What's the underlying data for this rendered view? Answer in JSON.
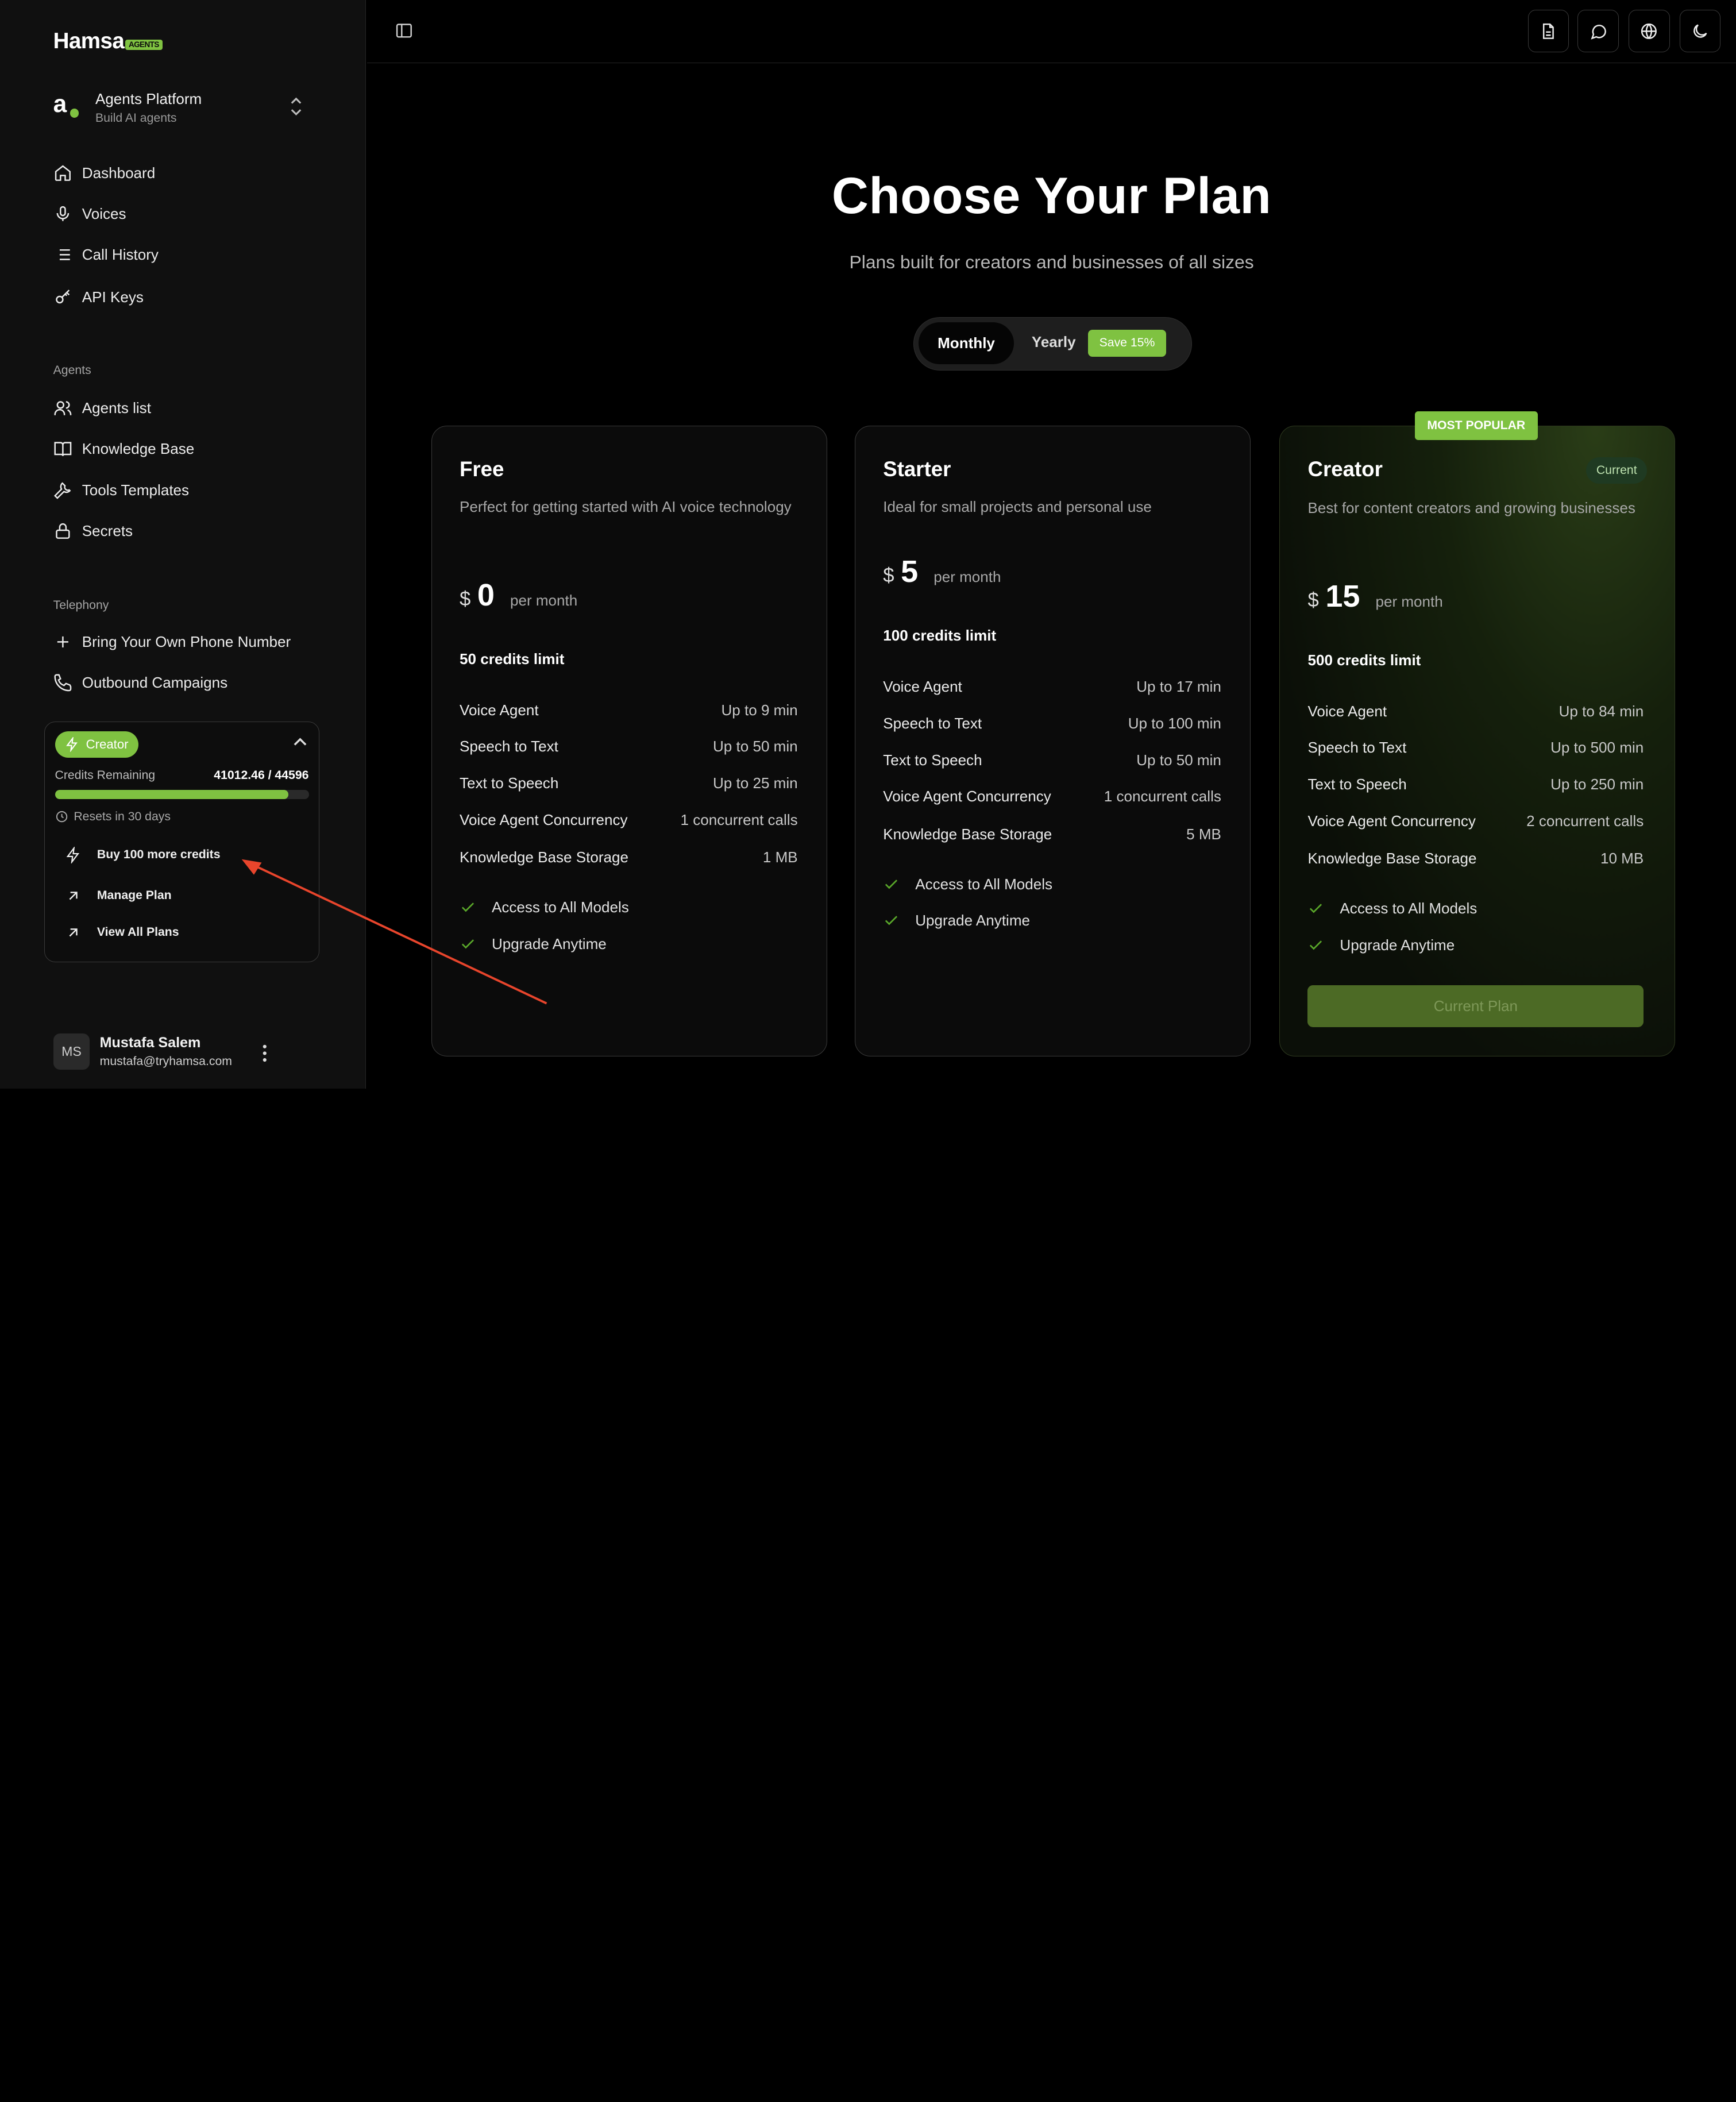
{
  "brand": {
    "name": "Hamsa",
    "tag": "AGENTS"
  },
  "workspace": {
    "title": "Agents Platform",
    "subtitle": "Build AI agents",
    "icon_letter": "a"
  },
  "nav": {
    "main": [
      {
        "label": "Dashboard",
        "icon": "home-icon"
      },
      {
        "label": "Voices",
        "icon": "microphone-icon"
      },
      {
        "label": "Call History",
        "icon": "list-icon"
      },
      {
        "label": "API Keys",
        "icon": "key-icon"
      }
    ],
    "agents_label": "Agents",
    "agents": [
      {
        "label": "Agents list",
        "icon": "users-icon"
      },
      {
        "label": "Knowledge Base",
        "icon": "book-icon"
      },
      {
        "label": "Tools Templates",
        "icon": "wrench-icon"
      },
      {
        "label": "Secrets",
        "icon": "lock-icon"
      }
    ],
    "telephony_label": "Telephony",
    "telephony": [
      {
        "label": "Bring Your Own Phone Number",
        "icon": "plus-icon"
      },
      {
        "label": "Outbound Campaigns",
        "icon": "phone-icon"
      }
    ]
  },
  "plan_widget": {
    "plan": "Creator",
    "credits_label": "Credits Remaining",
    "credits_value": "41012.46 / 44596",
    "credits_fraction": 0.9196,
    "resets": "Resets in 30 days",
    "links": [
      "Buy 100 more credits",
      "Manage Plan",
      "View All Plans"
    ]
  },
  "user": {
    "initials": "MS",
    "name": "Mustafa Salem",
    "email": "mustafa@tryhamsa.com"
  },
  "topbar": {
    "icons": [
      "document-icon",
      "chat-icon",
      "globe-icon",
      "moon-icon"
    ]
  },
  "hero": {
    "title": "Choose Your Plan",
    "subtitle": "Plans built for creators and businesses of all sizes"
  },
  "billing": {
    "monthly": "Monthly",
    "yearly": "Yearly",
    "save": "Save 15%",
    "selected": "Monthly"
  },
  "plans": [
    {
      "name": "Free",
      "desc": "Perfect for getting started with AI voice technology",
      "currency": "$",
      "price": "0",
      "period": "per month",
      "limit": "50 credits limit",
      "features": [
        {
          "k": "Voice Agent",
          "v": "Up to 9 min"
        },
        {
          "k": "Speech to Text",
          "v": "Up to 50 min"
        },
        {
          "k": "Text to Speech",
          "v": "Up to 25 min"
        },
        {
          "k": "Voice Agent Concurrency",
          "v": "1 concurrent calls"
        },
        {
          "k": "Knowledge Base Storage",
          "v": "1 MB"
        }
      ],
      "checks": [
        "Access to All Models",
        "Upgrade Anytime"
      ]
    },
    {
      "name": "Starter",
      "desc": "Ideal for small projects and personal use",
      "currency": "$",
      "price": "5",
      "period": "per month",
      "limit": "100 credits limit",
      "features": [
        {
          "k": "Voice Agent",
          "v": "Up to 17 min"
        },
        {
          "k": "Speech to Text",
          "v": "Up to 100 min"
        },
        {
          "k": "Text to Speech",
          "v": "Up to 50 min"
        },
        {
          "k": "Voice Agent Concurrency",
          "v": "1 concurrent calls"
        },
        {
          "k": "Knowledge Base Storage",
          "v": "5 MB"
        }
      ],
      "checks": [
        "Access to All Models",
        "Upgrade Anytime"
      ]
    },
    {
      "name": "Creator",
      "badge": "Current",
      "popular": "MOST POPULAR",
      "desc": "Best for content creators and growing businesses",
      "currency": "$",
      "price": "15",
      "period": "per month",
      "limit": "500 credits limit",
      "features": [
        {
          "k": "Voice Agent",
          "v": "Up to 84 min"
        },
        {
          "k": "Speech to Text",
          "v": "Up to 500 min"
        },
        {
          "k": "Text to Speech",
          "v": "Up to 250 min"
        },
        {
          "k": "Voice Agent Concurrency",
          "v": "2 concurrent calls"
        },
        {
          "k": "Knowledge Base Storage",
          "v": "10 MB"
        }
      ],
      "checks": [
        "Access to All Models",
        "Upgrade Anytime"
      ],
      "button": "Current Plan"
    }
  ],
  "colors": {
    "accent": "#7fc241",
    "annotation_arrow": "#e8452c"
  }
}
